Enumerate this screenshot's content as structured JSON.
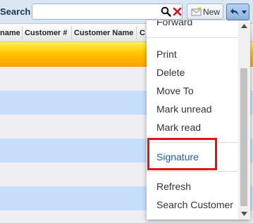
{
  "toolbar": {
    "search_label": "Search",
    "search_value": "",
    "search_placeholder": "",
    "new_label": "New"
  },
  "grid": {
    "columns": [
      "name",
      "Customer #",
      "Customer Name",
      "C"
    ]
  },
  "menu": {
    "items": [
      "Forward",
      "Print",
      "Delete",
      "Move To",
      "Mark unread",
      "Mark read",
      "Signature",
      "Refresh",
      "Search Customer"
    ],
    "highlighted_item": "Signature"
  },
  "colors": {
    "accent": "#1f5fa6",
    "highlight_border": "#e0121a",
    "row_blue": "#c7defa",
    "row_plain": "#eeeef3",
    "row_selected": "#ffc400"
  },
  "icons": {
    "search": "magnifier-icon",
    "clear": "red-x-icon",
    "new": "envelope-icon",
    "reply": "reply-arrow-icon"
  }
}
